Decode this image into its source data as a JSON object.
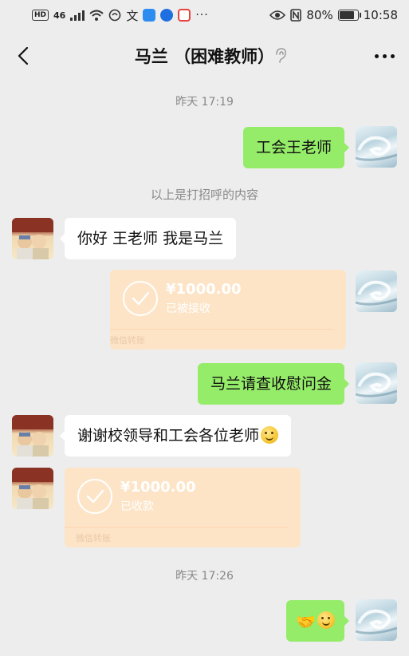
{
  "status_bar": {
    "hd": "HD",
    "net": "46",
    "vpn_glyph": "文",
    "more": "···",
    "battery": "80%",
    "time": "10:58",
    "icons": [
      "hd-icon",
      "signal-icon",
      "wifi-icon",
      "link-icon",
      "app-icon",
      "globe-icon",
      "app-red-icon",
      "eye-icon",
      "nfc-icon",
      "battery-icon"
    ]
  },
  "header": {
    "title": "马兰  （困难教师）"
  },
  "chat": {
    "time_1": "昨天 17:19",
    "msg_1": "工会王老师",
    "system_1": "以上是打招呼的内容",
    "msg_2": "你好 王老师 我是马兰",
    "transfer_1": {
      "amount": "¥1000.00",
      "status": "已被接收",
      "footer": "微信转账"
    },
    "msg_3": "马兰请查收慰问金",
    "msg_4": "谢谢校领导和工会各位老师",
    "transfer_2": {
      "amount": "¥1000.00",
      "status": "已收款",
      "footer": "微信转账"
    },
    "time_2": "昨天 17:26",
    "msg_5_emoji": [
      "handshake",
      "smile"
    ]
  },
  "colors": {
    "background": "#ededed",
    "bubble_me": "#95ec69",
    "bubble_them": "#ffffff",
    "transfer_card": "#fde4c7",
    "meta_text": "#888888"
  }
}
